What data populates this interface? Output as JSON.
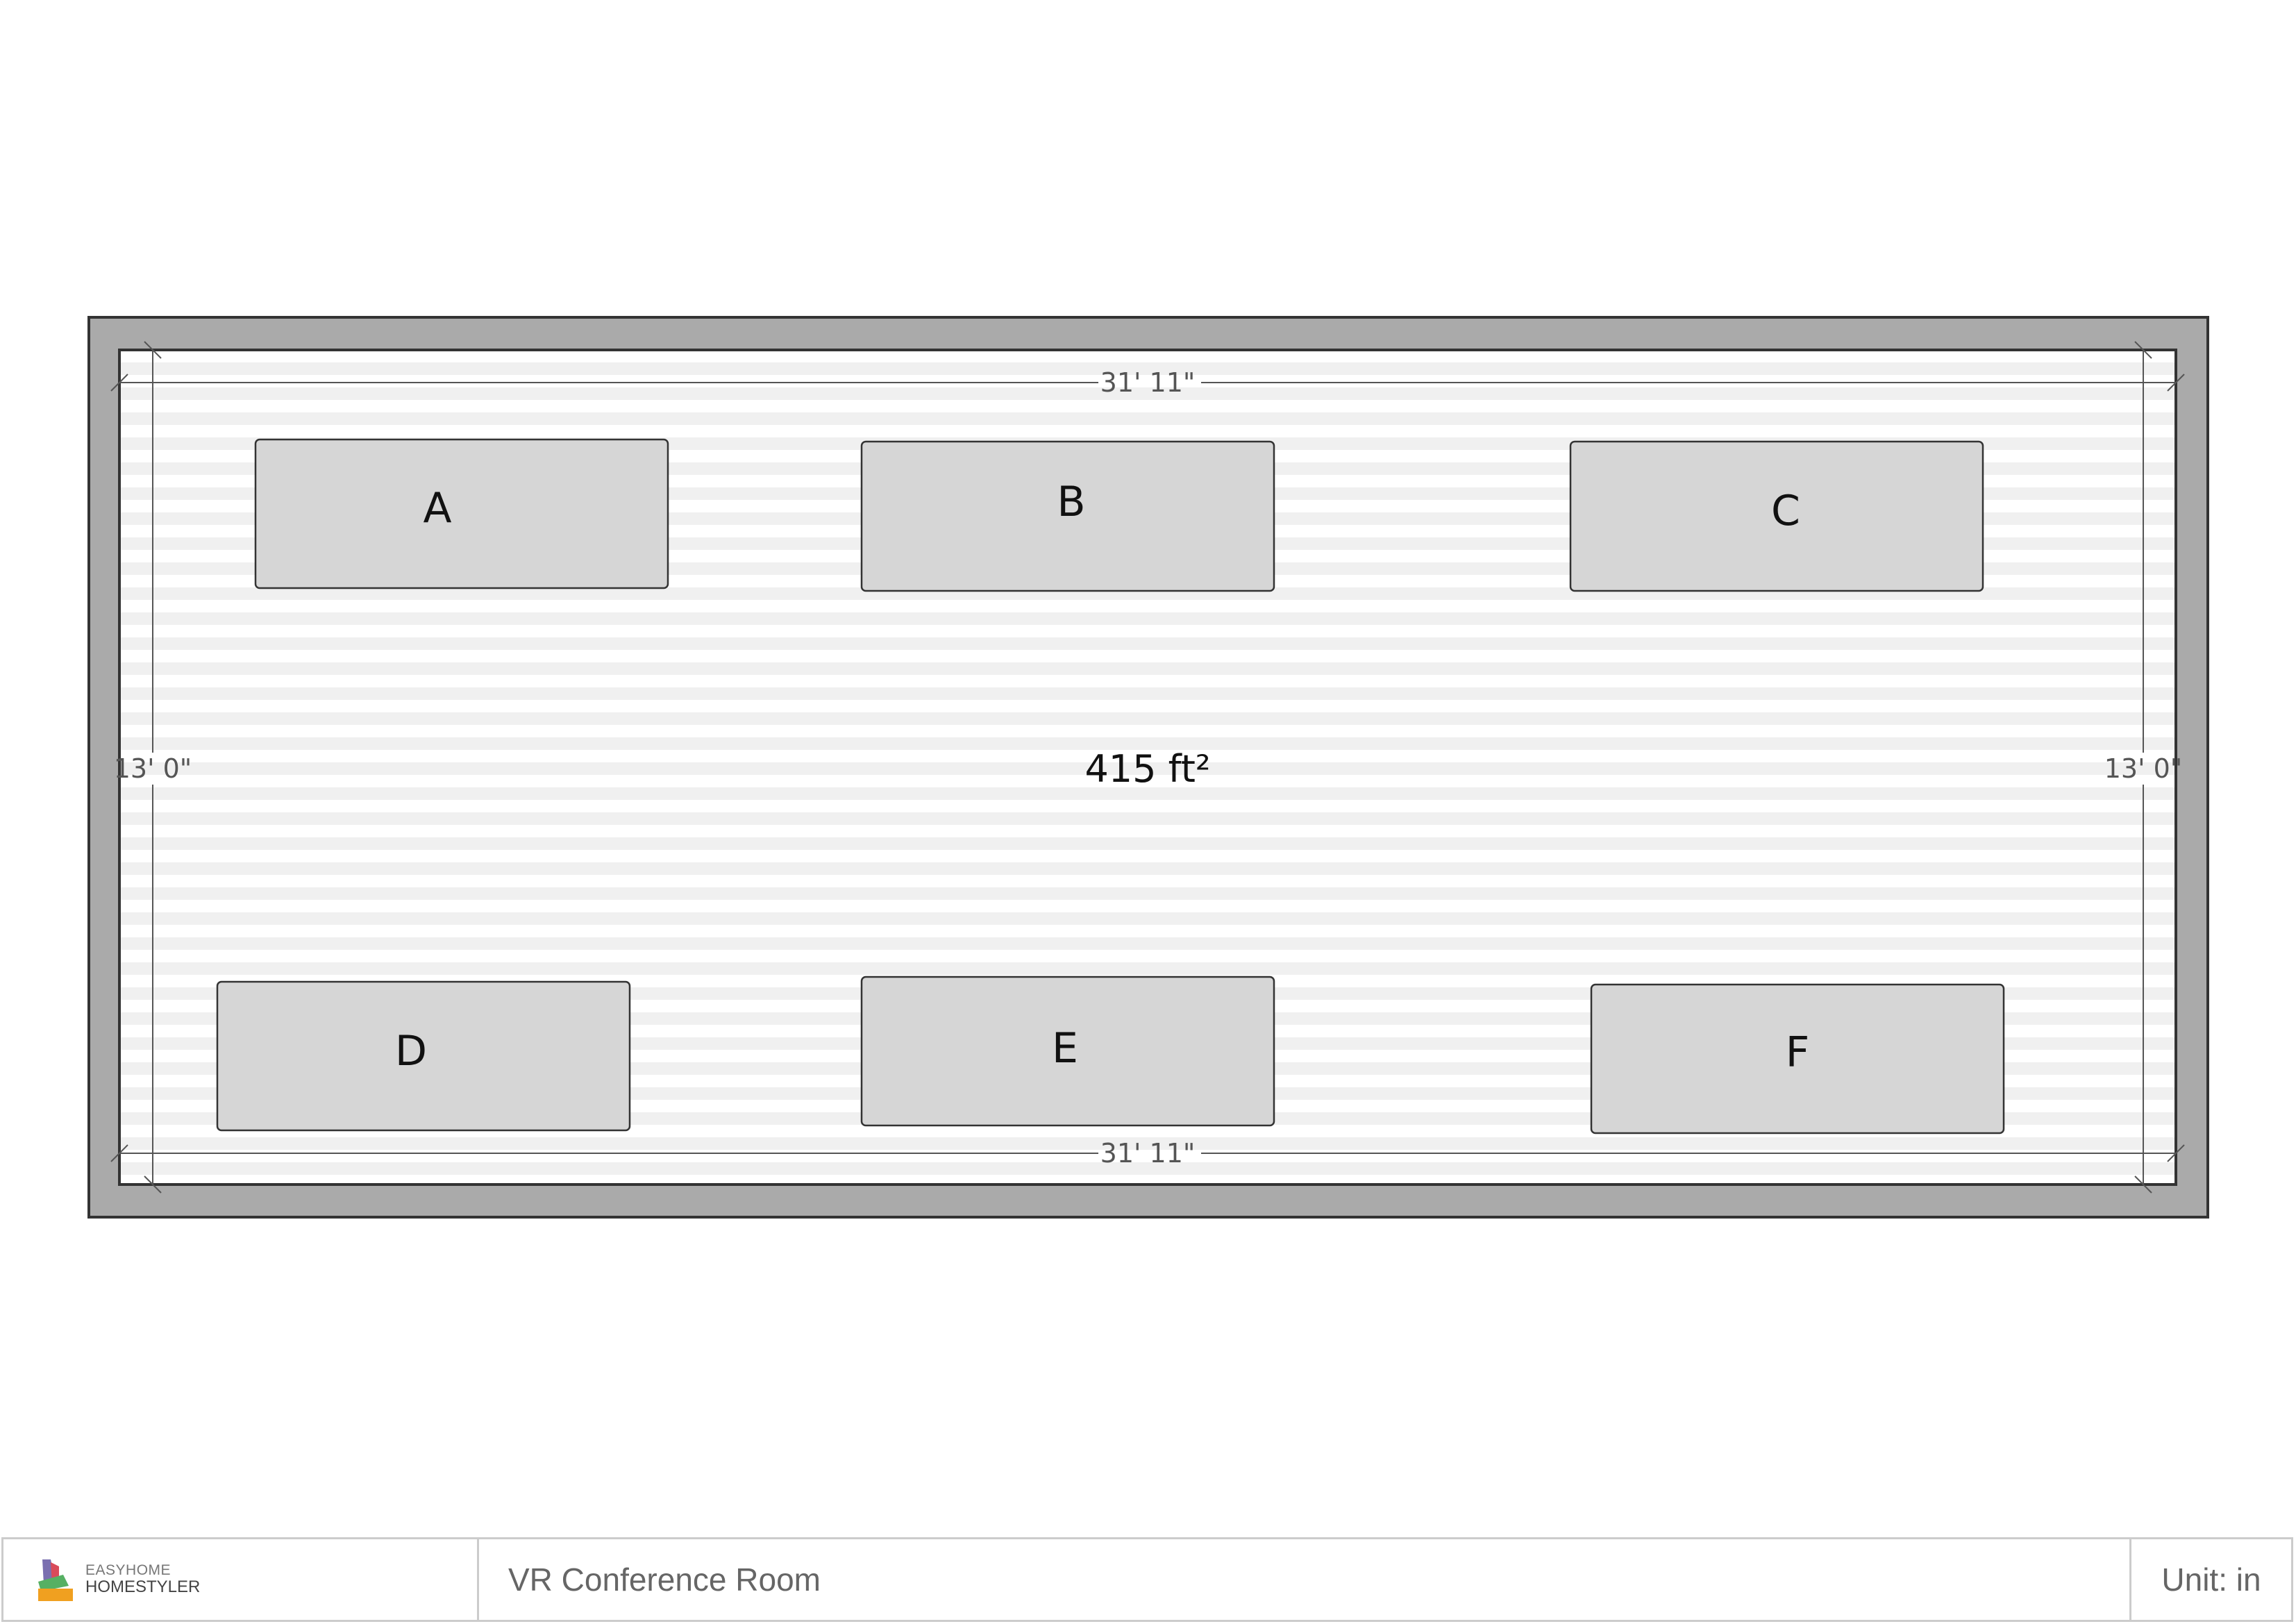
{
  "room": {
    "area": "415 ft²",
    "top_dimension": "31' 11\"",
    "bottom_dimension": "31' 11\"",
    "left_dimension": "13' 0\"",
    "right_dimension": "13' 0\"",
    "tables": [
      {
        "label": "A"
      },
      {
        "label": "B"
      },
      {
        "label": "C"
      },
      {
        "label": "D"
      },
      {
        "label": "E"
      },
      {
        "label": "F"
      }
    ]
  },
  "titlebar": {
    "logo": {
      "brand_top": "EASYHOME",
      "brand_bottom": "HOMESTYLER"
    },
    "project_name": "VR Conference Room",
    "unit": "Unit: in"
  }
}
